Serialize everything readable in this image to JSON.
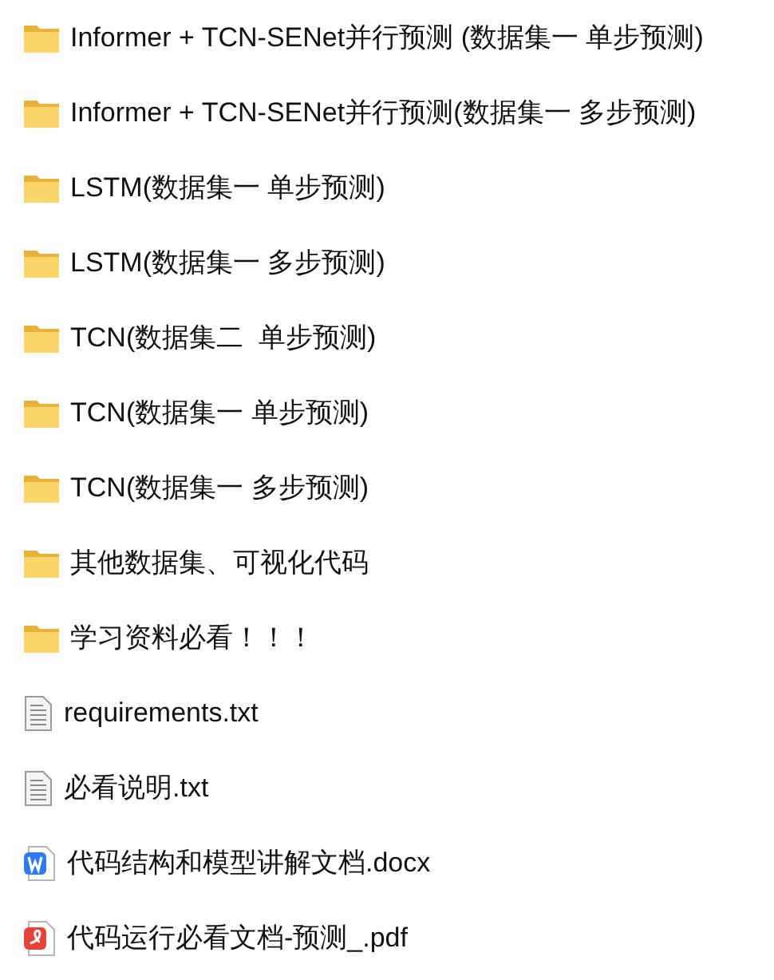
{
  "files": [
    {
      "kind": "folder",
      "name": "Informer + TCN-SENet并行预测 (数据集一 单步预测)"
    },
    {
      "kind": "folder",
      "name": "Informer + TCN-SENet并行预测(数据集一 多步预测)"
    },
    {
      "kind": "folder",
      "name": "LSTM(数据集一 单步预测)"
    },
    {
      "kind": "folder",
      "name": "LSTM(数据集一 多步预测)"
    },
    {
      "kind": "folder",
      "name": "TCN(数据集二  单步预测)"
    },
    {
      "kind": "folder",
      "name": "TCN(数据集一 单步预测)"
    },
    {
      "kind": "folder",
      "name": "TCN(数据集一 多步预测)"
    },
    {
      "kind": "folder",
      "name": "其他数据集、可视化代码"
    },
    {
      "kind": "folder",
      "name": "学习资料必看！！！"
    },
    {
      "kind": "text",
      "name": "requirements.txt"
    },
    {
      "kind": "text",
      "name": "必看说明.txt"
    },
    {
      "kind": "word",
      "name": "代码结构和模型讲解文档.docx"
    },
    {
      "kind": "pdf",
      "name": "代码运行必看文档-预测_.pdf"
    }
  ]
}
